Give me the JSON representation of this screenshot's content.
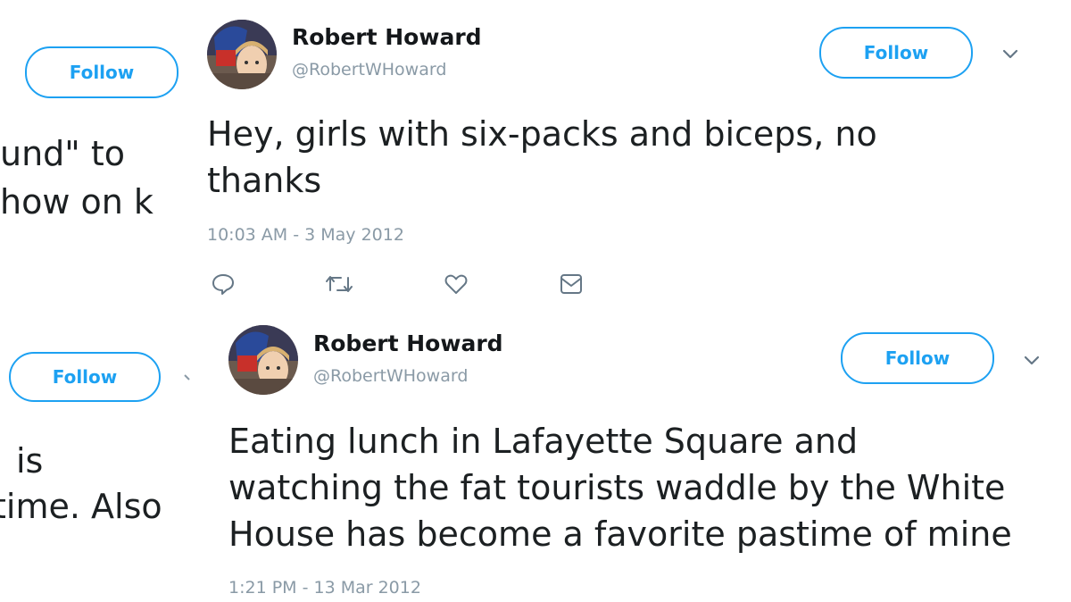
{
  "left_column": {
    "follow_top_label": "Follow",
    "follow_bottom_label": "Follow",
    "text_fragments": [
      "und\" to",
      "how on k",
      "is",
      "time. Also"
    ]
  },
  "tweets": [
    {
      "name": "Robert Howard",
      "handle": "@RobertWHoward",
      "follow_label": "Follow",
      "text_lines": [
        "Hey, girls with six-packs and biceps, no",
        "thanks"
      ],
      "timestamp": "10:03 AM - 3 May 2012",
      "actions": [
        "reply-icon",
        "retweet-icon",
        "like-icon",
        "direct-message-icon"
      ]
    },
    {
      "name": "Robert Howard",
      "handle": "@RobertWHoward",
      "follow_label": "Follow",
      "text_lines": [
        "Eating lunch in Lafayette Square and",
        "watching the fat tourists waddle by the White",
        "House has become a favorite pastime of mine"
      ],
      "timestamp": "1:21 PM - 13 Mar 2012"
    }
  ],
  "colors": {
    "accent": "#1da1f2",
    "text": "#1c2022",
    "muted": "#8a9aa6"
  }
}
